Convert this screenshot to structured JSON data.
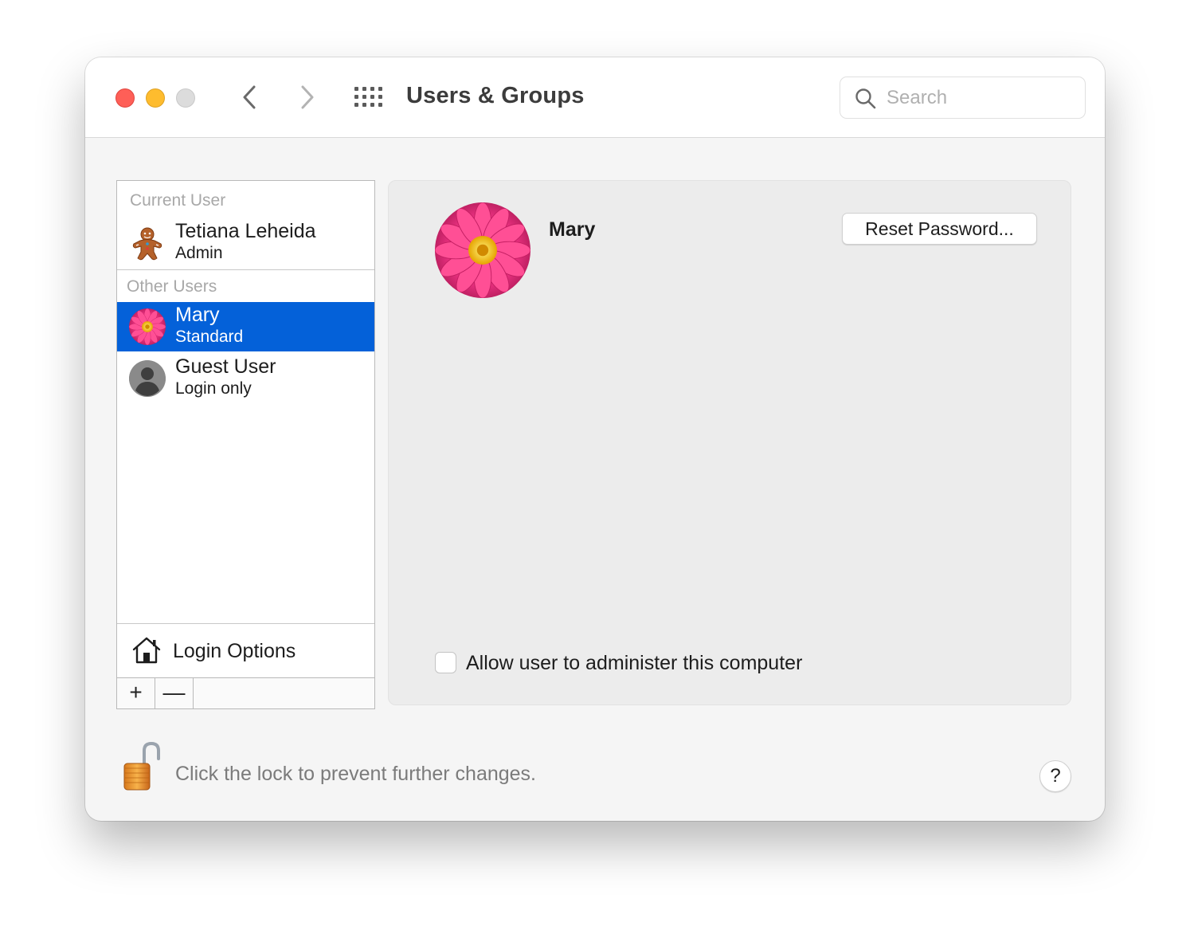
{
  "window": {
    "title": "Users & Groups",
    "search_placeholder": "Search"
  },
  "sidebar": {
    "current_user_label": "Current User",
    "other_users_label": "Other Users",
    "users": [
      {
        "name": "Tetiana Leheida",
        "role": "Admin",
        "avatar": "gingerbread-avatar",
        "selected": false
      },
      {
        "name": "Mary",
        "role": "Standard",
        "avatar": "pink-flower-avatar",
        "selected": true
      },
      {
        "name": "Guest User",
        "role": "Login only",
        "avatar": "generic-person-avatar",
        "selected": false
      }
    ],
    "login_options_label": "Login Options",
    "add_symbol": "+",
    "remove_symbol": "—"
  },
  "detail": {
    "user_name": "Mary",
    "reset_password_label": "Reset Password...",
    "admin_checkbox_label": "Allow user to administer this computer",
    "admin_checked": false
  },
  "footer": {
    "lock_text": "Click the lock to prevent further changes.",
    "help_symbol": "?"
  },
  "colors": {
    "selection": "#0461d9",
    "close": "#fe5f57",
    "minimize": "#febc2e",
    "zoom": "#dcdcdc",
    "flower": "#e8307f"
  }
}
